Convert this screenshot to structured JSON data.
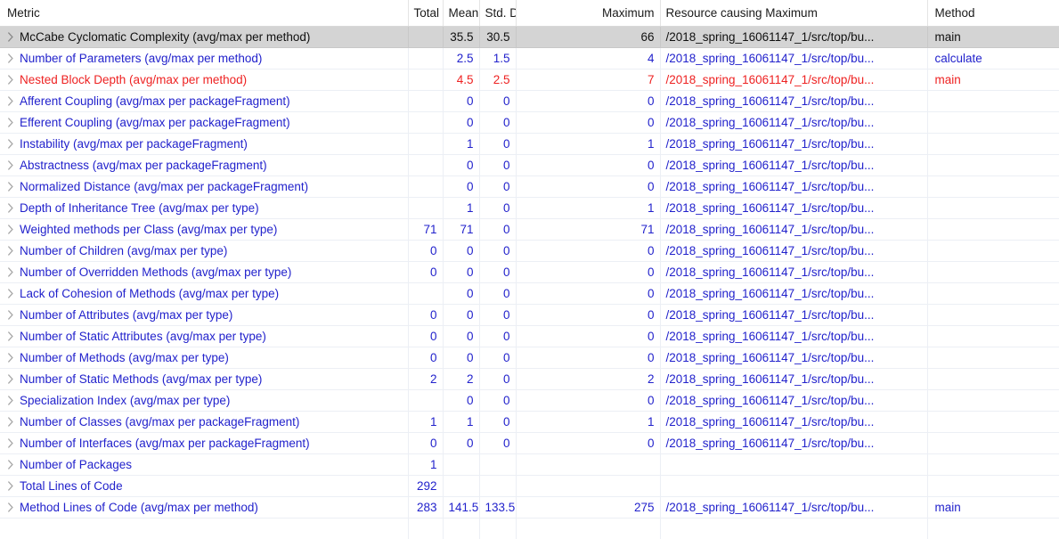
{
  "view": {
    "name": "metrics-table-view"
  },
  "columns": [
    {
      "key": "metric",
      "label": "Metric",
      "align": "left"
    },
    {
      "key": "total",
      "label": "Total",
      "align": "right"
    },
    {
      "key": "mean",
      "label": "Mean",
      "align": "right"
    },
    {
      "key": "std",
      "label": "Std. Dev.",
      "align": "right"
    },
    {
      "key": "max",
      "label": "Maximum",
      "align": "right"
    },
    {
      "key": "resource",
      "label": "Resource causing Maximum",
      "align": "left"
    },
    {
      "key": "method",
      "label": "Method",
      "align": "left"
    }
  ],
  "icons": {
    "expand": "chevron-right-icon"
  },
  "colors": {
    "normal": "#2222cc",
    "alert": "#ee2222",
    "selected_row_background": "#d4d4d4",
    "header_text": "#1a1a1a",
    "grid_line": "#eceff5"
  },
  "rows": [
    {
      "metric": "McCabe Cyclomatic Complexity (avg/max per method)",
      "total": "",
      "mean": "35.5",
      "std": "30.5",
      "max": "66",
      "resource": "/2018_spring_16061147_1/src/top/bu...",
      "method": "main",
      "severity": "selected",
      "selected": true
    },
    {
      "metric": "Number of Parameters (avg/max per method)",
      "total": "",
      "mean": "2.5",
      "std": "1.5",
      "max": "4",
      "resource": "/2018_spring_16061147_1/src/top/bu...",
      "method": "calculate",
      "severity": "normal",
      "selected": false
    },
    {
      "metric": "Nested Block Depth (avg/max per method)",
      "total": "",
      "mean": "4.5",
      "std": "2.5",
      "max": "7",
      "resource": "/2018_spring_16061147_1/src/top/bu...",
      "method": "main",
      "severity": "alert",
      "selected": false
    },
    {
      "metric": "Afferent Coupling (avg/max per packageFragment)",
      "total": "",
      "mean": "0",
      "std": "0",
      "max": "0",
      "resource": "/2018_spring_16061147_1/src/top/bu...",
      "method": "",
      "severity": "normal",
      "selected": false
    },
    {
      "metric": "Efferent Coupling (avg/max per packageFragment)",
      "total": "",
      "mean": "0",
      "std": "0",
      "max": "0",
      "resource": "/2018_spring_16061147_1/src/top/bu...",
      "method": "",
      "severity": "normal",
      "selected": false
    },
    {
      "metric": "Instability (avg/max per packageFragment)",
      "total": "",
      "mean": "1",
      "std": "0",
      "max": "1",
      "resource": "/2018_spring_16061147_1/src/top/bu...",
      "method": "",
      "severity": "normal",
      "selected": false
    },
    {
      "metric": "Abstractness (avg/max per packageFragment)",
      "total": "",
      "mean": "0",
      "std": "0",
      "max": "0",
      "resource": "/2018_spring_16061147_1/src/top/bu...",
      "method": "",
      "severity": "normal",
      "selected": false
    },
    {
      "metric": "Normalized Distance (avg/max per packageFragment)",
      "total": "",
      "mean": "0",
      "std": "0",
      "max": "0",
      "resource": "/2018_spring_16061147_1/src/top/bu...",
      "method": "",
      "severity": "normal",
      "selected": false
    },
    {
      "metric": "Depth of Inheritance Tree (avg/max per type)",
      "total": "",
      "mean": "1",
      "std": "0",
      "max": "1",
      "resource": "/2018_spring_16061147_1/src/top/bu...",
      "method": "",
      "severity": "normal",
      "selected": false
    },
    {
      "metric": "Weighted methods per Class (avg/max per type)",
      "total": "71",
      "mean": "71",
      "std": "0",
      "max": "71",
      "resource": "/2018_spring_16061147_1/src/top/bu...",
      "method": "",
      "severity": "normal",
      "selected": false
    },
    {
      "metric": "Number of Children (avg/max per type)",
      "total": "0",
      "mean": "0",
      "std": "0",
      "max": "0",
      "resource": "/2018_spring_16061147_1/src/top/bu...",
      "method": "",
      "severity": "normal",
      "selected": false
    },
    {
      "metric": "Number of Overridden Methods (avg/max per type)",
      "total": "0",
      "mean": "0",
      "std": "0",
      "max": "0",
      "resource": "/2018_spring_16061147_1/src/top/bu...",
      "method": "",
      "severity": "normal",
      "selected": false
    },
    {
      "metric": "Lack of Cohesion of Methods (avg/max per type)",
      "total": "",
      "mean": "0",
      "std": "0",
      "max": "0",
      "resource": "/2018_spring_16061147_1/src/top/bu...",
      "method": "",
      "severity": "normal",
      "selected": false
    },
    {
      "metric": "Number of Attributes (avg/max per type)",
      "total": "0",
      "mean": "0",
      "std": "0",
      "max": "0",
      "resource": "/2018_spring_16061147_1/src/top/bu...",
      "method": "",
      "severity": "normal",
      "selected": false
    },
    {
      "metric": "Number of Static Attributes (avg/max per type)",
      "total": "0",
      "mean": "0",
      "std": "0",
      "max": "0",
      "resource": "/2018_spring_16061147_1/src/top/bu...",
      "method": "",
      "severity": "normal",
      "selected": false
    },
    {
      "metric": "Number of Methods (avg/max per type)",
      "total": "0",
      "mean": "0",
      "std": "0",
      "max": "0",
      "resource": "/2018_spring_16061147_1/src/top/bu...",
      "method": "",
      "severity": "normal",
      "selected": false
    },
    {
      "metric": "Number of Static Methods (avg/max per type)",
      "total": "2",
      "mean": "2",
      "std": "0",
      "max": "2",
      "resource": "/2018_spring_16061147_1/src/top/bu...",
      "method": "",
      "severity": "normal",
      "selected": false
    },
    {
      "metric": "Specialization Index (avg/max per type)",
      "total": "",
      "mean": "0",
      "std": "0",
      "max": "0",
      "resource": "/2018_spring_16061147_1/src/top/bu...",
      "method": "",
      "severity": "normal",
      "selected": false
    },
    {
      "metric": "Number of Classes (avg/max per packageFragment)",
      "total": "1",
      "mean": "1",
      "std": "0",
      "max": "1",
      "resource": "/2018_spring_16061147_1/src/top/bu...",
      "method": "",
      "severity": "normal",
      "selected": false
    },
    {
      "metric": "Number of Interfaces (avg/max per packageFragment)",
      "total": "0",
      "mean": "0",
      "std": "0",
      "max": "0",
      "resource": "/2018_spring_16061147_1/src/top/bu...",
      "method": "",
      "severity": "normal",
      "selected": false
    },
    {
      "metric": "Number of Packages",
      "total": "1",
      "mean": "",
      "std": "",
      "max": "",
      "resource": "",
      "method": "",
      "severity": "normal",
      "selected": false
    },
    {
      "metric": "Total Lines of Code",
      "total": "292",
      "mean": "",
      "std": "",
      "max": "",
      "resource": "",
      "method": "",
      "severity": "normal",
      "selected": false
    },
    {
      "metric": "Method Lines of Code (avg/max per method)",
      "total": "283",
      "mean": "141.5",
      "std": "133.5",
      "max": "275",
      "resource": "/2018_spring_16061147_1/src/top/bu...",
      "method": "main",
      "severity": "normal",
      "selected": false
    }
  ]
}
